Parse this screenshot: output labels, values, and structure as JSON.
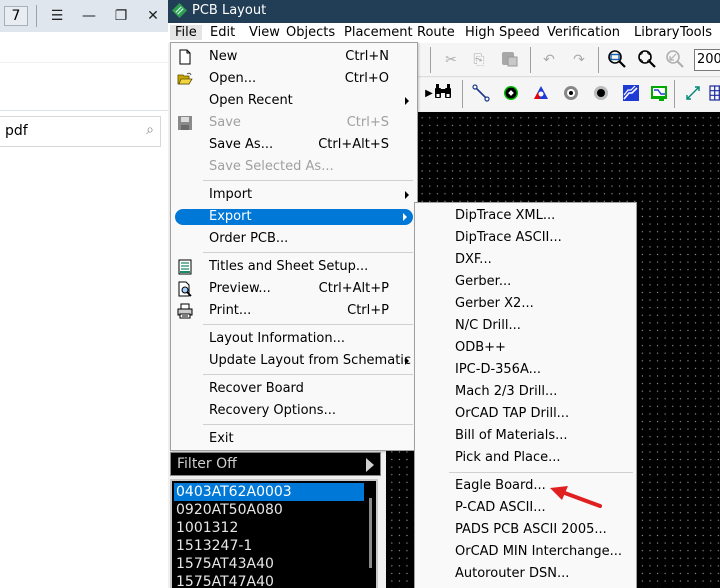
{
  "left_window": {
    "page_number": "7",
    "icons": [
      "menu-icon",
      "minimize-icon",
      "restore-icon",
      "close-icon"
    ],
    "search_value": "pdf",
    "search_icon": "search-icon"
  },
  "app": {
    "title": "PCB Layout",
    "menubar": [
      "File",
      "Edit",
      "View",
      "Objects",
      "Placement",
      "Route",
      "High Speed",
      "Verification",
      "Library",
      "Tools"
    ],
    "active_menu": "File",
    "zoom_value": "200"
  },
  "toolbar1": [
    "cut-icon",
    "copy-icon",
    "paste-icon",
    "undo-icon",
    "redo-icon",
    "zoom-window-icon",
    "zoom-extents-icon",
    "zoom-previous-icon"
  ],
  "toolbar2": [
    "find-icon",
    "route-trace-icon",
    "pad-icon",
    "via-icon",
    "hole-icon",
    "mounting-hole-icon",
    "copper-pour-icon",
    "board-outline-icon",
    "measure-icon",
    "grid-icon"
  ],
  "file_menu": {
    "items": [
      {
        "label": "New",
        "shortcut": "Ctrl+N",
        "icon": "new-file-icon"
      },
      {
        "label": "Open...",
        "shortcut": "Ctrl+O",
        "icon": "open-folder-icon"
      },
      {
        "label": "Open Recent",
        "submenu": true
      },
      {
        "label": "Save",
        "shortcut": "Ctrl+S",
        "icon": "save-icon",
        "disabled": true
      },
      {
        "label": "Save As...",
        "shortcut": "Ctrl+Alt+S"
      },
      {
        "label": "Save Selected As...",
        "disabled": true
      },
      {
        "label": "Import",
        "submenu": true
      },
      {
        "label": "Export",
        "submenu": true,
        "highlighted": true
      },
      {
        "label": "Order PCB..."
      },
      {
        "label": "Titles and Sheet Setup...",
        "icon": "titles-icon"
      },
      {
        "label": "Preview...",
        "shortcut": "Ctrl+Alt+P",
        "icon": "preview-icon"
      },
      {
        "label": "Print...",
        "shortcut": "Ctrl+P",
        "icon": "print-icon"
      },
      {
        "label": "Layout Information..."
      },
      {
        "label": "Update Layout from Schematic",
        "submenu": true
      },
      {
        "label": "Recover Board"
      },
      {
        "label": "Recovery Options..."
      },
      {
        "label": "Exit"
      }
    ]
  },
  "export_menu": {
    "items": [
      "DipTrace XML...",
      "DipTrace ASCII...",
      "DXF...",
      "Gerber...",
      "Gerber X2...",
      "N/C Drill...",
      "ODB++",
      "IPC-D-356A...",
      "Mach 2/3 Drill...",
      "OrCAD TAP Drill...",
      "Bill of Materials...",
      "Pick and Place...",
      "Eagle Board...",
      "P-CAD ASCII...",
      "PADS PCB ASCII 2005...",
      "OrCAD MIN Interchange...",
      "Autorouter DSN..."
    ],
    "annotated_item": "Eagle Board..."
  },
  "side_panel": {
    "filter_label": "Filter Off",
    "parts": [
      "0403AT62A0003",
      "0920AT50A080",
      "1001312",
      "1513247-1",
      "1575AT43A40",
      "1575AT47A40"
    ],
    "selected_part": "0403AT62A0003"
  },
  "colors": {
    "title_bar": "#223d56",
    "highlight": "#0078d7",
    "annotation_arrow": "#e02020",
    "canvas": "#000000"
  }
}
